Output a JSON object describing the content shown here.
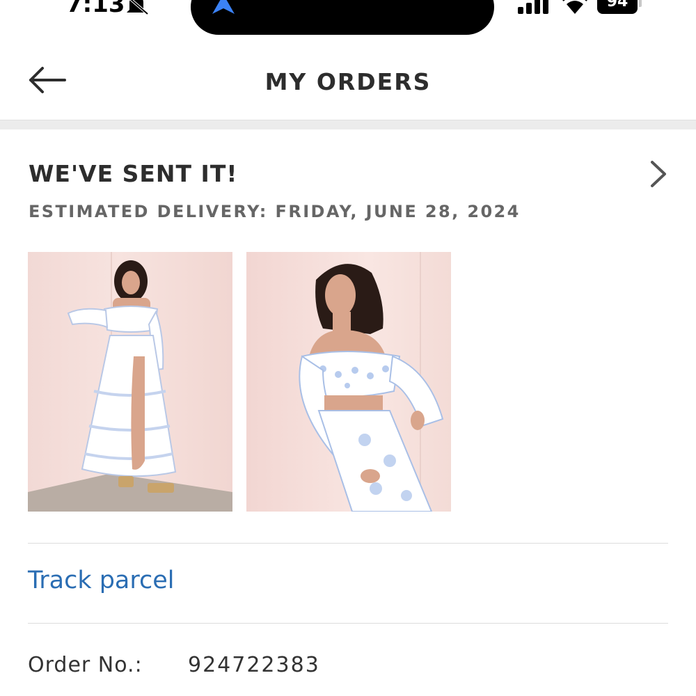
{
  "status_bar": {
    "time": "7:13",
    "battery": "94"
  },
  "header": {
    "title": "MY ORDERS"
  },
  "order": {
    "status_title": "WE'VE SENT IT!",
    "delivery": "ESTIMATED DELIVERY: FRIDAY, JUNE 28, 2024",
    "track_label": "Track parcel",
    "order_no_label": "Order No.:",
    "order_no": "924722383"
  },
  "colors": {
    "link": "#2a6db3",
    "background": "#ffffff",
    "divider": "#ececec",
    "text": "#2d2d2d",
    "subtext": "#666666"
  },
  "icons": [
    "bell-slash-icon",
    "navigation-arrow-icon",
    "signal-icon",
    "wifi-icon",
    "battery-icon",
    "back-arrow-icon",
    "chevron-right-icon"
  ]
}
